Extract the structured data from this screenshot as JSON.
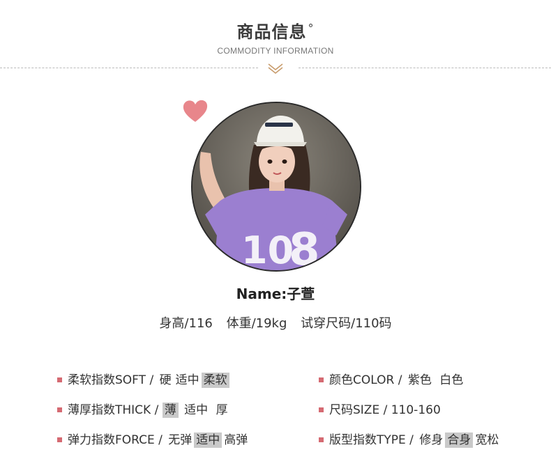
{
  "header": {
    "title_cn": "商品信息",
    "title_dot": "°",
    "title_en": "COMMODITY INFORMATION"
  },
  "model": {
    "name": "Name:子萱",
    "height": "身高/116",
    "weight": "体重/19kg",
    "size": "试穿尺码/110码"
  },
  "specs": {
    "soft": {
      "label": "柔软指数SOFT /",
      "options": [
        "硬",
        "适中",
        "柔软"
      ],
      "selected": 2
    },
    "thick": {
      "label": "薄厚指数THICK /",
      "options": [
        "薄",
        "适中",
        "厚"
      ],
      "selected": 0
    },
    "force": {
      "label": "弹力指数FORCE /",
      "options": [
        "无弹",
        "适中",
        "高弹"
      ],
      "selected": 1
    },
    "color": {
      "label": "颜色COLOR /",
      "options": [
        "紫色",
        "白色"
      ]
    },
    "size": {
      "label": "尺码SIZE /",
      "value": "110-160"
    },
    "type": {
      "label": "版型指数TYPE /",
      "options": [
        "修身",
        "合身",
        "宽松"
      ],
      "selected": 1
    }
  },
  "colors": {
    "bullet": "#d56a72",
    "highlight": "#c9c9c9",
    "heart": "#e8868b"
  }
}
